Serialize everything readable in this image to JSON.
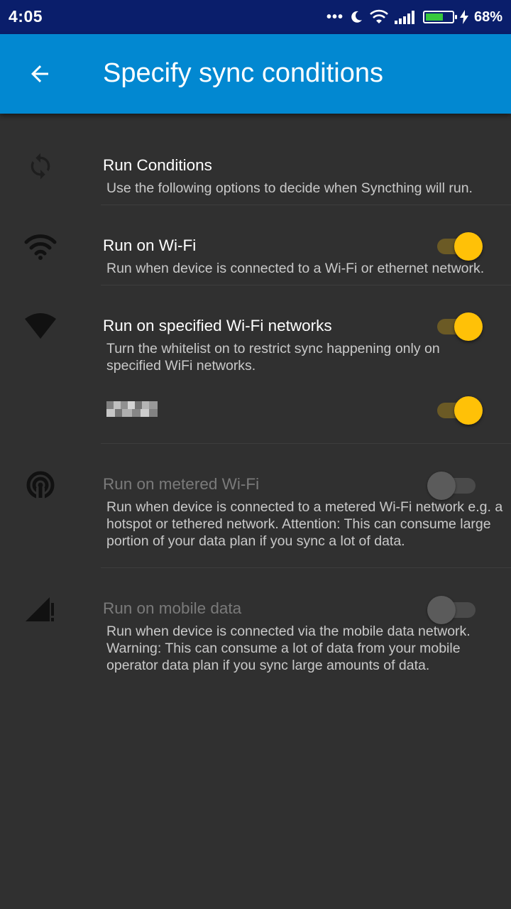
{
  "status_bar": {
    "time": "4:05",
    "dots": "•••",
    "battery_percent": "68%",
    "battery_level": 0.68,
    "icons": [
      "dots-icon",
      "moon-icon",
      "wifi-signal-icon",
      "cell-signal-icon",
      "battery-icon",
      "charging-bolt-icon"
    ],
    "battery_color": "#37c93d"
  },
  "app_bar": {
    "title": "Specify sync conditions",
    "back_icon": "arrow-back-icon",
    "color": "#0288d1"
  },
  "preferences": [
    {
      "title": "Run Conditions",
      "summary": "Use the following options to decide when Syncthing will run.",
      "icon": "sync-icon"
    },
    {
      "title": "Run on Wi-Fi",
      "summary": "Run when device is connected to a Wi-Fi or ethernet network.",
      "icon": "wifi-icon",
      "enabled": true,
      "checked": true
    },
    {
      "title": "Run on specified Wi-Fi networks",
      "summary": "Turn the whitelist on to restrict sync happening only on specified WiFi networks.",
      "icon": "wifi-filled-icon",
      "enabled": true,
      "checked": true,
      "network_switch_checked": true
    },
    {
      "title": "Run on metered Wi-Fi",
      "summary": "Run when device is connected to a metered Wi-Fi network e.g. a hotspot or tethered network. Attention: This can consume large portion of your data plan if you sync a lot of data.",
      "icon": "hotspot-icon",
      "enabled": false,
      "checked": false
    },
    {
      "title": "Run on mobile data",
      "summary": "Run when device is connected via the mobile data network. Warning: This can consume a lot of data from your mobile operator data plan if you sync large amounts of data.",
      "icon": "cell-warning-icon",
      "enabled": false,
      "checked": false
    }
  ],
  "accent_color": "#ffc107",
  "background_color": "#303030"
}
